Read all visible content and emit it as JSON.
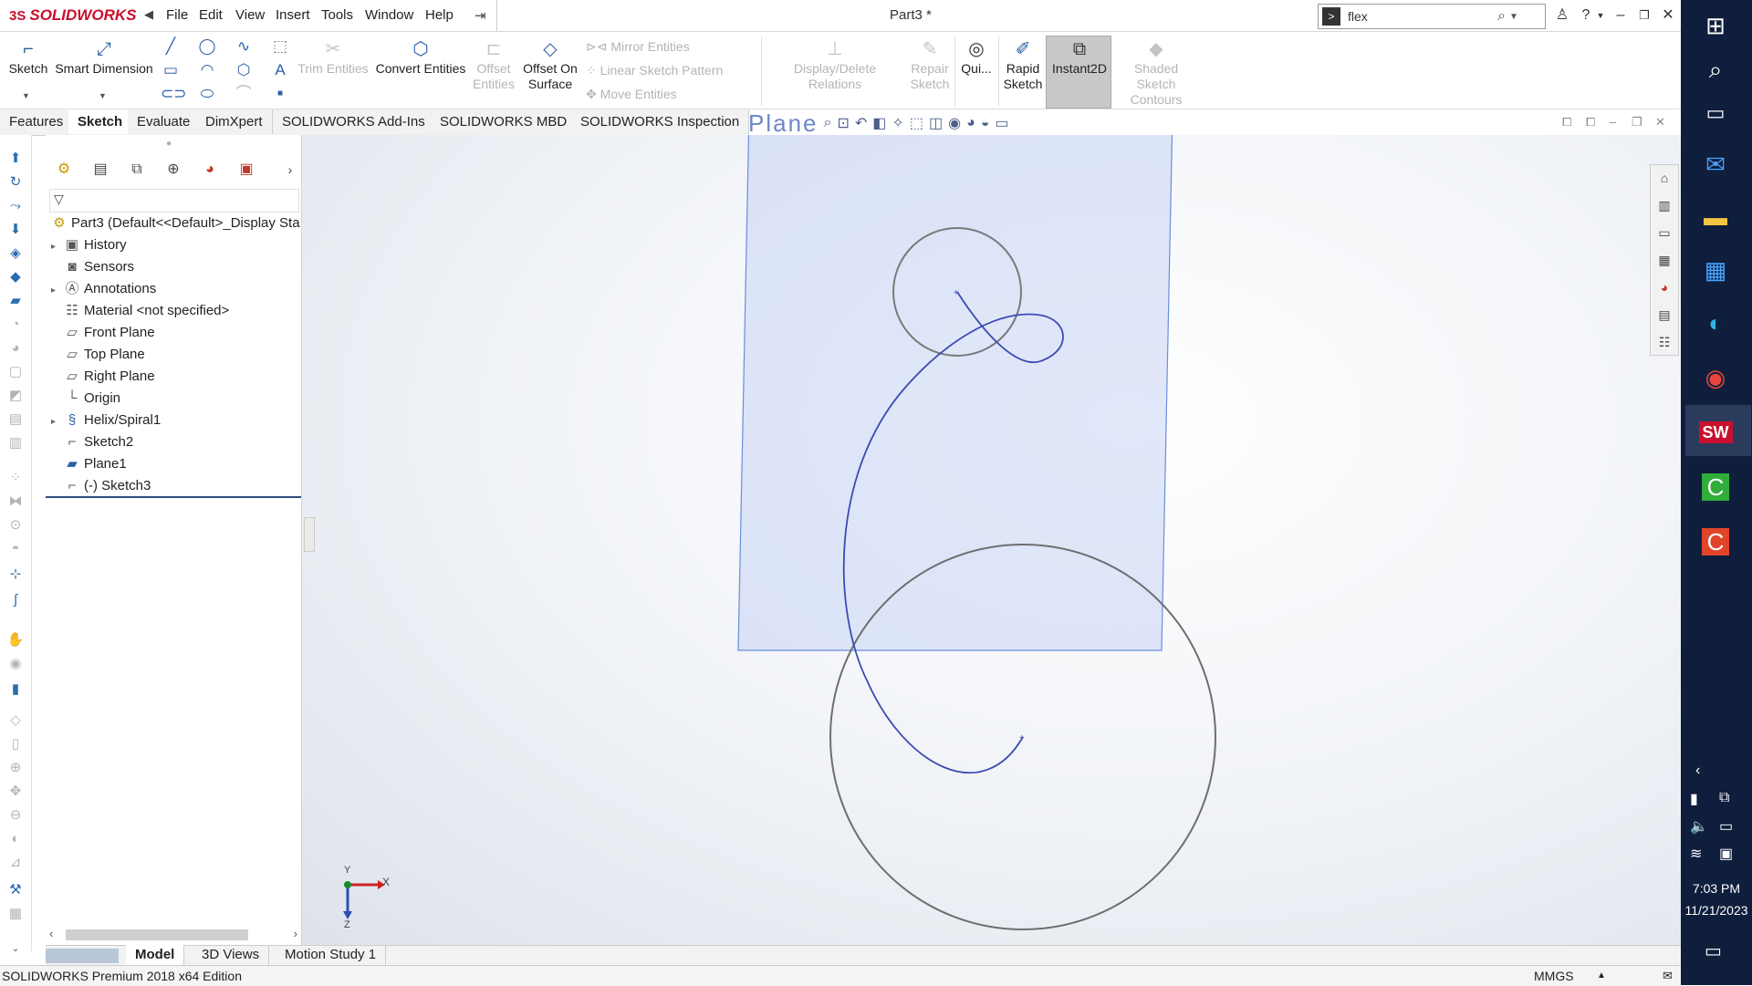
{
  "app": {
    "logo_text": "SOLIDWORKS",
    "logo_mark": "3S",
    "document_title": "Part3 *"
  },
  "menu": [
    "File",
    "Edit",
    "View",
    "Insert",
    "Tools",
    "Window",
    "Help"
  ],
  "search": {
    "value": "flex"
  },
  "ribbon": {
    "sketch": "Sketch",
    "smart_dimension": "Smart Dimension",
    "trim_entities": "Trim Entities",
    "convert_entities": "Convert Entities",
    "offset_entities_1": "Offset",
    "offset_entities_2": "Entities",
    "offset_on_surface_1": "Offset On",
    "offset_on_surface_2": "Surface",
    "mirror_entities": "Mirror Entities",
    "linear_sketch_pattern": "Linear Sketch Pattern",
    "move_entities": "Move Entities",
    "display_delete_relations": "Display/Delete Relations",
    "repair_sketch_1": "Repair",
    "repair_sketch_2": "Sketch",
    "quick_snaps": "Qui...",
    "rapid_sketch_1": "Rapid",
    "rapid_sketch_2": "Sketch",
    "instant2d": "Instant2D",
    "shaded_contours_1": "Shaded Sketch",
    "shaded_contours_2": "Contours"
  },
  "tabs": [
    "Features",
    "Sketch",
    "Evaluate",
    "DimXpert",
    "SOLIDWORKS Add-Ins",
    "SOLIDWORKS MBD",
    "SOLIDWORKS Inspection"
  ],
  "active_tab": "Sketch",
  "tree": {
    "root": "Part3  (Default<<Default>_Display Sta",
    "items": [
      "History",
      "Sensors",
      "Annotations",
      "Material <not specified>",
      "Front Plane",
      "Top Plane",
      "Right Plane",
      "Origin",
      "Helix/Spiral1",
      "Sketch2",
      "Plane1",
      "(-) Sketch3"
    ]
  },
  "viewport": {
    "plane_label": "Plane",
    "axis_x": "X",
    "axis_y": "Y",
    "axis_z": "Z"
  },
  "bottom_tabs": [
    "Model",
    "3D Views",
    "Motion Study 1"
  ],
  "status": {
    "edition": "SOLIDWORKS Premium 2018 x64 Edition",
    "units": "MMGS"
  },
  "taskbar": {
    "time": "7:03 PM",
    "date": "11/21/2023"
  },
  "colors": {
    "accent": "#2b5fa6",
    "logo": "#c8102e",
    "sketch_curve": "#3d4bb4",
    "plane_border": "#6a8de0",
    "taskbar": "#0f1e3c"
  }
}
